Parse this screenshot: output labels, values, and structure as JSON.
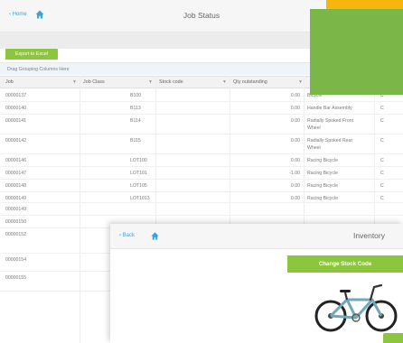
{
  "job_status": {
    "back_label": "‹ Home",
    "title": "Job Status",
    "export_label": "Export to Excel",
    "drag_hint": "Drag Grouping Columns Here",
    "columns": [
      "Job",
      "Job Class",
      "Stock code",
      "Qty outstanding"
    ],
    "rows": [
      {
        "job": "00000137",
        "code": "B100",
        "qty": "0.00",
        "desc": "Bicycle",
        "c": "C"
      },
      {
        "job": "00000140",
        "code": "B113",
        "qty": "0.00",
        "desc": "Handle Bar Assembly",
        "c": "C"
      },
      {
        "job": "00000141",
        "code": "B114",
        "qty": "0.00",
        "desc": "Radially Spoked Front Wheel",
        "c": "C"
      },
      {
        "job": "00000142",
        "code": "B115",
        "qty": "0.00",
        "desc": "Radially Spoked Rear Wheel",
        "c": "C"
      },
      {
        "job": "00000146",
        "code": "LOT100",
        "qty": "0.00",
        "desc": "Racing Bicycle",
        "c": "C"
      },
      {
        "job": "00000147",
        "code": "LOT101",
        "qty": "-1.00",
        "desc": "Racing Bicycle",
        "c": "C"
      },
      {
        "job": "00000148",
        "code": "LOT105",
        "qty": "0.00",
        "desc": "Racing Bicycle",
        "c": "C"
      },
      {
        "job": "00000149",
        "code": "LOT1013",
        "qty": "0.00",
        "desc": "Racing Bicycle",
        "c": "C"
      },
      {
        "job": "00000149",
        "code": "",
        "qty": "",
        "desc": "",
        "c": ""
      },
      {
        "job": "00000150",
        "code": "",
        "qty": "",
        "desc": "",
        "c": ""
      },
      {
        "job": "00000152",
        "code": "",
        "qty": "",
        "desc": "",
        "c": ""
      },
      {
        "job": "00000154",
        "code": "",
        "qty": "",
        "desc": "",
        "c": ""
      },
      {
        "job": "00000155",
        "code": "",
        "qty": "",
        "desc": "",
        "c": ""
      }
    ]
  },
  "inventory": {
    "back_label": "‹ Back",
    "title": "Inventory",
    "change_stock_label": "Change Stock Code"
  },
  "colors": {
    "accent_green": "#8cc63f",
    "square_green": "#7ab648",
    "tab_yellow": "#f6b60d",
    "link_blue": "#3aa6d8"
  }
}
